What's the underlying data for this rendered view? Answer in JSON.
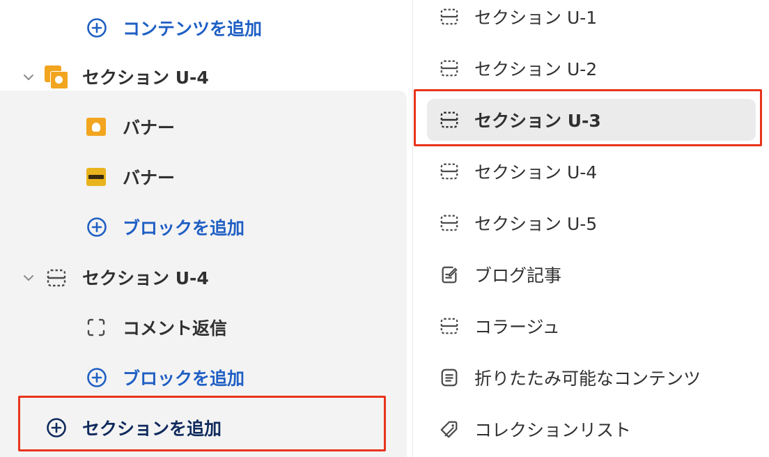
{
  "tree": {
    "add_content_label": "コンテンツを追加",
    "section_with_banners": {
      "title": "セクション U-4",
      "blocks": [
        {
          "label": "バナー",
          "thumb": "banner-orange"
        },
        {
          "label": "バナー",
          "thumb": "banner-yellow"
        }
      ],
      "add_block_label": "ブロックを追加"
    },
    "section_with_comment": {
      "title": "セクション U-4",
      "blocks": [
        {
          "label": "コメント返信",
          "icon": "dashed-square-icon"
        }
      ],
      "add_block_label": "ブロックを追加"
    },
    "add_section_label": "セクションを追加"
  },
  "section_menu": {
    "selected_index": 2,
    "items": [
      {
        "label": "セクション U-1",
        "icon": "section-icon"
      },
      {
        "label": "セクション U-2",
        "icon": "section-icon"
      },
      {
        "label": "セクション U-3",
        "icon": "section-icon"
      },
      {
        "label": "セクション U-4",
        "icon": "section-icon"
      },
      {
        "label": "セクション U-5",
        "icon": "section-icon"
      },
      {
        "label": "ブログ記事",
        "icon": "blog-post-icon"
      },
      {
        "label": "コラージュ",
        "icon": "section-icon"
      },
      {
        "label": "折りたたみ可能なコンテンツ",
        "icon": "collapsible-content-icon"
      },
      {
        "label": "コレクションリスト",
        "icon": "tag-icon"
      }
    ]
  },
  "colors": {
    "highlight_border": "#e8341c",
    "link_blue": "#1f5fc4",
    "selected_bg": "#ebebeb",
    "nested_bg": "#f3f3f3"
  }
}
